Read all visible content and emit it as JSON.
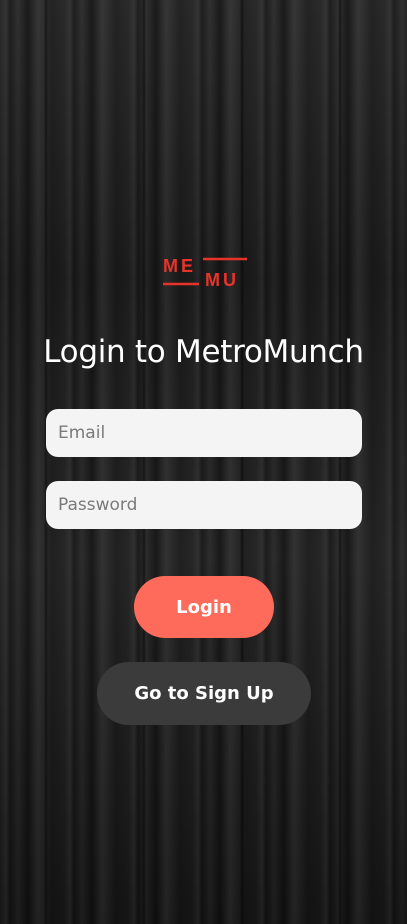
{
  "status_bar": {
    "left_text": "",
    "right_text": ""
  },
  "logo": {
    "top_letters": "ME",
    "bottom_letters": "MU",
    "color": "#e8332a"
  },
  "title": "Login to MetroMunch",
  "form": {
    "email_placeholder": "Email",
    "email_value": "",
    "password_placeholder": "Password",
    "password_value": ""
  },
  "buttons": {
    "login_label": "Login",
    "signup_label": "Go to Sign Up"
  },
  "colors": {
    "accent": "#ff6b5b",
    "secondary_button": "#3b3b3b",
    "input_background": "#f4f4f4"
  }
}
